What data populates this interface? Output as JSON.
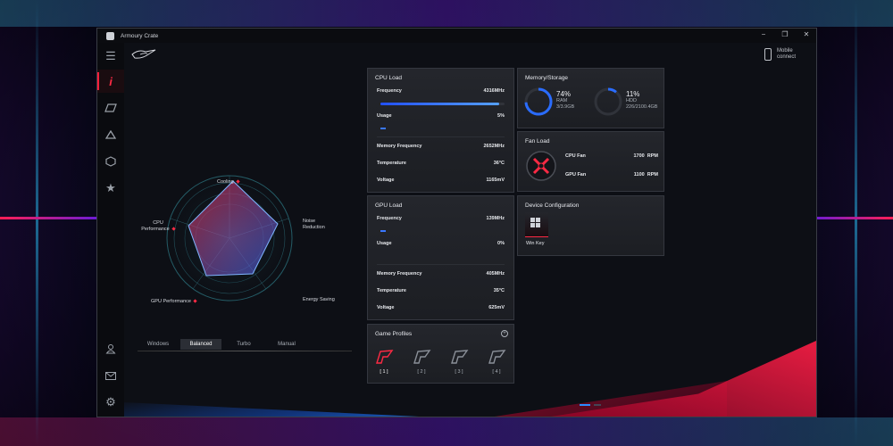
{
  "window": {
    "title": "Armoury Crate"
  },
  "header": {
    "mobile_connect": "Mobile connect"
  },
  "radar": {
    "labels": {
      "cooling": "Cooling",
      "cpu_performance": "CPU Performance",
      "noise_reduction": "Noise Reduction",
      "gpu_performance": "GPU Performance",
      "energy_saving": "Energy Saving"
    }
  },
  "modes": {
    "items": [
      "Windows",
      "Balanced",
      "Turbo",
      "Manual"
    ],
    "active": "Balanced"
  },
  "cpu": {
    "title": "CPU Load",
    "frequency_label": "Frequency",
    "frequency_value": "4316MHz",
    "frequency_fraction": 0.96,
    "usage_label": "Usage",
    "usage_value": "5%",
    "memfreq_label": "Memory Frequency",
    "memfreq_value": "2652MHz",
    "temp_label": "Temperature",
    "temp_value": "36°C",
    "voltage_label": "Voltage",
    "voltage_value": "1165mV"
  },
  "gpu": {
    "title": "GPU Load",
    "frequency_label": "Frequency",
    "frequency_value": "139MHz",
    "usage_label": "Usage",
    "usage_value": "0%",
    "memfreq_label": "Memory Frequency",
    "memfreq_value": "405MHz",
    "temp_label": "Temperature",
    "temp_value": "35°C",
    "voltage_label": "Voltage",
    "voltage_value": "625mV"
  },
  "memory": {
    "title": "Memory/Storage",
    "ram": {
      "percent": "74%",
      "label": "RAM",
      "detail": "3/3.9GB",
      "fraction": 0.74
    },
    "hdd": {
      "percent": "11%",
      "label": "HDD",
      "detail": "226/2100.4GB",
      "fraction": 0.11
    }
  },
  "fan": {
    "title": "Fan Load",
    "cpu_fan_label": "CPU Fan",
    "cpu_fan_value": "1700  RPM",
    "gpu_fan_label": "GPU Fan",
    "gpu_fan_value": "1100  RPM"
  },
  "device": {
    "title": "Device Configuration",
    "win_key_label": "Win Key"
  },
  "profiles": {
    "title": "Game Profiles",
    "items": [
      "[ 1 ]",
      "[ 2 ]",
      "[ 3 ]",
      "[ 4 ]"
    ],
    "active_index": 0
  },
  "colors": {
    "accent_red": "#ff1e3c",
    "accent_blue": "#2a6cff"
  },
  "icons": [
    "menu-icon",
    "info-icon",
    "scenario-icon",
    "aura-icon",
    "armoury-icon",
    "featured-icon",
    "user-icon",
    "mail-icon",
    "settings-icon"
  ]
}
